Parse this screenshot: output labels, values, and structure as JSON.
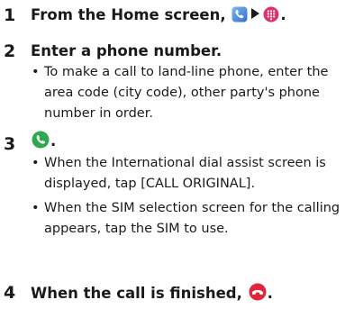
{
  "steps": [
    {
      "number": "1",
      "title_before": "From the Home screen, ",
      "title_after": ".",
      "icons": [
        "phone-app-icon",
        "dialpad-icon"
      ]
    },
    {
      "number": "2",
      "title": "Enter a phone number.",
      "bullets": [
        "To make a call to land-line phone, enter the area code (city code), other party's phone number in order."
      ]
    },
    {
      "number": "3",
      "title_after": ".",
      "icons": [
        "call-button-icon"
      ],
      "bullets": [
        "When the International dial assist screen is displayed, tap [CALL ORIGINAL].",
        "When the SIM selection screen for the calling appears, tap the SIM to use."
      ]
    },
    {
      "number": "4",
      "title_before": "When the call is finished, ",
      "title_after": ".",
      "icons": [
        "end-call-icon"
      ]
    }
  ],
  "colors": {
    "phone_app": "#3a7fd5",
    "dialpad": "#e0306e",
    "call_green": "#2fa84f",
    "end_call_red": "#e0243a",
    "text": "#1a1a1a"
  }
}
